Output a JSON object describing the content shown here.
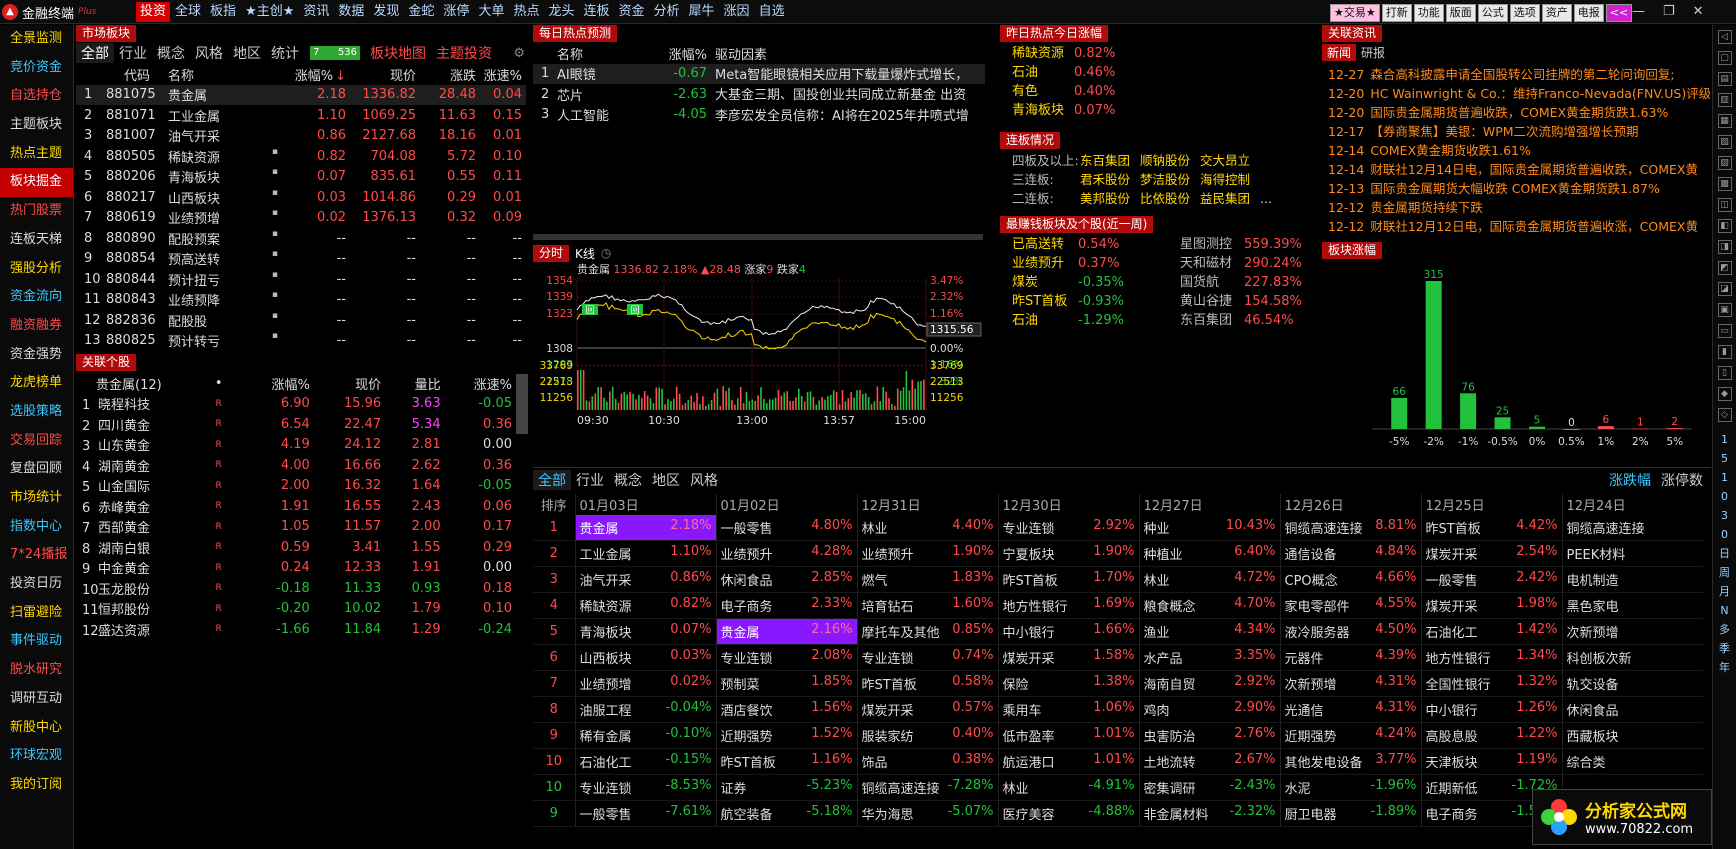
{
  "app": {
    "title": "金融终端",
    "tag": "Plus"
  },
  "menu": [
    "投资",
    "全球",
    "板指",
    "★主创★",
    "资讯",
    "数据",
    "发现",
    "金蛇",
    "涨停",
    "大单",
    "热点",
    "龙头",
    "连板",
    "资金",
    "分析",
    "犀牛",
    "涨因",
    "自选"
  ],
  "top_buttons": [
    "★交易★",
    "打新",
    "功能",
    "版面",
    "公式",
    "选项",
    "资产",
    "电报",
    "<<"
  ],
  "window_controls": [
    "—",
    "❐",
    "✕"
  ],
  "left_nav": [
    {
      "l": "全景监测",
      "c": "y"
    },
    {
      "l": "竞价资金",
      "c": "c"
    },
    {
      "l": "自选持仓",
      "c": "r"
    },
    {
      "l": "主题板块",
      "c": "w"
    },
    {
      "l": "热点主题",
      "c": "y"
    },
    {
      "l": "板块掘金",
      "c": "act"
    },
    {
      "l": "热门股票",
      "c": "r"
    },
    {
      "l": "连板天梯",
      "c": "w"
    },
    {
      "l": "强股分析",
      "c": "y"
    },
    {
      "l": "资金流向",
      "c": "c"
    },
    {
      "l": "融资融券",
      "c": "r"
    },
    {
      "l": "资金强势",
      "c": "w"
    },
    {
      "l": "龙虎榜单",
      "c": "y"
    },
    {
      "l": "选股策略",
      "c": "c"
    },
    {
      "l": "交易回踪",
      "c": "r"
    },
    {
      "l": "复盘回顾",
      "c": "w"
    },
    {
      "l": "市场统计",
      "c": "y"
    },
    {
      "l": "指数中心",
      "c": "c"
    },
    {
      "l": "7*24播报",
      "c": "r"
    },
    {
      "l": "投资日历",
      "c": "w"
    },
    {
      "l": "扫雷避险",
      "c": "y"
    },
    {
      "l": "事件驱动",
      "c": "c"
    },
    {
      "l": "脱水研究",
      "c": "r"
    },
    {
      "l": "调研互动",
      "c": "w"
    },
    {
      "l": "新股中心",
      "c": "y"
    },
    {
      "l": "环球宏观",
      "c": "c"
    },
    {
      "l": "我的订阅",
      "c": "y"
    }
  ],
  "right_tool_text": [
    "1",
    "5",
    "1",
    "0",
    "3",
    "0",
    "日",
    "周",
    "月",
    "N",
    "多",
    "季",
    "年"
  ],
  "market": {
    "header": "市场板块",
    "tabs": [
      "全部",
      "行业",
      "概念",
      "风格",
      "地区",
      "统计"
    ],
    "count_box": {
      "a": "7",
      "b": "536"
    },
    "links": [
      "板块地图",
      "主题投资"
    ],
    "cols": [
      "",
      "代码",
      "名称",
      "涨幅%",
      "现价",
      "涨跌",
      "涨速%"
    ],
    "sort_mark": "↓",
    "rows": [
      {
        "n": "1",
        "code": "881075",
        "name": "贵金属",
        "dot": "",
        "pct": "2.18",
        "px": "1336.82",
        "chg": "28.48",
        "spd": "0.04",
        "c": "r",
        "sel": true
      },
      {
        "n": "2",
        "code": "881071",
        "name": "工业金属",
        "dot": "",
        "pct": "1.10",
        "px": "1069.25",
        "chg": "11.63",
        "spd": "0.15",
        "c": "r"
      },
      {
        "n": "3",
        "code": "881007",
        "name": "油气开采",
        "dot": "",
        "pct": "0.86",
        "px": "2127.68",
        "chg": "18.16",
        "spd": "0.01",
        "c": "r"
      },
      {
        "n": "4",
        "code": "880505",
        "name": "稀缺资源",
        "dot": "▪",
        "pct": "0.82",
        "px": "704.08",
        "chg": "5.72",
        "spd": "0.10",
        "c": "r"
      },
      {
        "n": "5",
        "code": "880206",
        "name": "青海板块",
        "dot": "▪",
        "pct": "0.07",
        "px": "835.61",
        "chg": "0.55",
        "spd": "0.11",
        "c": "r"
      },
      {
        "n": "6",
        "code": "880217",
        "name": "山西板块",
        "dot": "▪",
        "pct": "0.03",
        "px": "1014.86",
        "chg": "0.29",
        "spd": "0.01",
        "c": "r"
      },
      {
        "n": "7",
        "code": "880619",
        "name": "业绩预增",
        "dot": "▪",
        "pct": "0.02",
        "px": "1376.13",
        "chg": "0.32",
        "spd": "0.09",
        "c": "r"
      },
      {
        "n": "8",
        "code": "880890",
        "name": "配股预案",
        "dot": "▪",
        "pct": "--",
        "px": "--",
        "chg": "--",
        "spd": "--",
        "c": "w"
      },
      {
        "n": "9",
        "code": "880854",
        "name": "预高送转",
        "dot": "▪",
        "pct": "--",
        "px": "--",
        "chg": "--",
        "spd": "--",
        "c": "w"
      },
      {
        "n": "10",
        "code": "880844",
        "name": "预计扭亏",
        "dot": "▪",
        "pct": "--",
        "px": "--",
        "chg": "--",
        "spd": "--",
        "c": "w"
      },
      {
        "n": "11",
        "code": "880843",
        "name": "业绩预降",
        "dot": "▪",
        "pct": "--",
        "px": "--",
        "chg": "--",
        "spd": "--",
        "c": "w"
      },
      {
        "n": "12",
        "code": "882836",
        "name": "配股股",
        "dot": "▪",
        "pct": "--",
        "px": "--",
        "chg": "--",
        "spd": "--",
        "c": "w"
      },
      {
        "n": "13",
        "code": "880825",
        "name": "预计转亏",
        "dot": "▪",
        "pct": "--",
        "px": "--",
        "chg": "--",
        "spd": "--",
        "c": "w"
      }
    ]
  },
  "related": {
    "header": "关联个股",
    "cols": [
      "贵金属(12)",
      "•",
      "涨幅%",
      "现价",
      "量比",
      "涨速%"
    ],
    "rows": [
      {
        "n": "1",
        "name": "晓程科技",
        "pct": "6.90",
        "px": "15.96",
        "vr": "3.63",
        "spd": "-0.05",
        "c": "r",
        "vc": "m",
        "sc": "g"
      },
      {
        "n": "2",
        "name": "四川黄金",
        "pct": "6.54",
        "px": "22.47",
        "vr": "5.34",
        "spd": "0.36",
        "c": "r",
        "vc": "m",
        "sc": "r"
      },
      {
        "n": "3",
        "name": "山东黄金",
        "pct": "4.19",
        "px": "24.12",
        "vr": "2.81",
        "spd": "0.00",
        "c": "r",
        "vc": "r",
        "sc": "w"
      },
      {
        "n": "4",
        "name": "湖南黄金",
        "pct": "4.00",
        "px": "16.66",
        "vr": "2.62",
        "spd": "0.36",
        "c": "r",
        "vc": "r",
        "sc": "r"
      },
      {
        "n": "5",
        "name": "山金国际",
        "pct": "2.00",
        "px": "16.32",
        "vr": "1.64",
        "spd": "-0.05",
        "c": "r",
        "vc": "r",
        "sc": "g"
      },
      {
        "n": "6",
        "name": "赤峰黄金",
        "pct": "1.91",
        "px": "16.55",
        "vr": "2.43",
        "spd": "0.06",
        "c": "r",
        "vc": "r",
        "sc": "r"
      },
      {
        "n": "7",
        "name": "西部黄金",
        "pct": "1.05",
        "px": "11.57",
        "vr": "2.00",
        "spd": "0.17",
        "c": "r",
        "vc": "r",
        "sc": "r"
      },
      {
        "n": "8",
        "name": "湖南白银",
        "pct": "0.59",
        "px": "3.41",
        "vr": "1.55",
        "spd": "0.29",
        "c": "r",
        "vc": "r",
        "sc": "r"
      },
      {
        "n": "9",
        "name": "中金黄金",
        "pct": "0.24",
        "px": "12.33",
        "vr": "1.91",
        "spd": "0.00",
        "c": "r",
        "vc": "r",
        "sc": "w"
      },
      {
        "n": "10",
        "name": "玉龙股份",
        "pct": "-0.18",
        "px": "11.33",
        "vr": "0.93",
        "spd": "0.18",
        "c": "g",
        "vc": "g",
        "sc": "r"
      },
      {
        "n": "11",
        "name": "恒邦股份",
        "pct": "-0.20",
        "px": "10.02",
        "vr": "1.79",
        "spd": "0.10",
        "c": "g",
        "vc": "r",
        "sc": "r"
      },
      {
        "n": "12",
        "name": "盛达资源",
        "pct": "-1.66",
        "px": "11.84",
        "vr": "1.29",
        "spd": "-0.24",
        "c": "g",
        "vc": "r",
        "sc": "g"
      }
    ]
  },
  "hot": {
    "header": "每日热点预测",
    "cols": [
      "名称",
      "涨幅%",
      "驱动因素"
    ],
    "rows": [
      {
        "n": "1",
        "name": "AI眼镜",
        "pct": "-0.67",
        "desc": "Meta智能眼镜相关应用下载量爆炸式增长，"
      },
      {
        "n": "2",
        "name": "芯片",
        "pct": "-2.63",
        "desc": "大基金三期、国投创业共同成立新基金 出资"
      },
      {
        "n": "3",
        "name": "人工智能",
        "pct": "-4.05",
        "desc": "李彦宏发全员信称：AI将在2025年井喷式增"
      }
    ]
  },
  "yesterday": {
    "header": "昨日热点今日涨幅",
    "rows": [
      {
        "name": "稀缺资源",
        "pct": "0.82%"
      },
      {
        "name": "石油",
        "pct": "0.46%"
      },
      {
        "name": "有色",
        "pct": "0.40%"
      },
      {
        "name": "青海板块",
        "pct": "0.07%"
      }
    ]
  },
  "board": {
    "header": "连板情况",
    "rows": [
      {
        "label": "四板及以上:",
        "stocks": [
          "东百集团",
          "顺钠股份",
          "交大昂立"
        ],
        "more": ""
      },
      {
        "label": "三连板:",
        "stocks": [
          "君禾股份",
          "梦洁股份",
          "海得控制"
        ],
        "more": ""
      },
      {
        "label": "二连板:",
        "stocks": [
          "美邦股份",
          "比依股份",
          "益民集团"
        ],
        "more": "..."
      }
    ]
  },
  "profit": {
    "header": "最赚钱板块及个股(近一周)",
    "left": [
      {
        "name": "已高送转",
        "pct": "0.54%",
        "c": "r"
      },
      {
        "name": "业绩预升",
        "pct": "0.37%",
        "c": "r"
      },
      {
        "name": "煤炭",
        "pct": "-0.35%",
        "c": "g"
      },
      {
        "name": "昨ST首板",
        "pct": "-0.93%",
        "c": "g"
      },
      {
        "name": "石油",
        "pct": "-1.29%",
        "c": "g"
      }
    ],
    "right": [
      {
        "name": "星图测控",
        "pct": "559.39%"
      },
      {
        "name": "天和磁材",
        "pct": "290.24%"
      },
      {
        "name": "国货航",
        "pct": "227.83%"
      },
      {
        "name": "黄山谷捷",
        "pct": "154.58%"
      },
      {
        "name": "东百集团",
        "pct": "46.54%"
      }
    ]
  },
  "news": {
    "header": "关联资讯",
    "tabs": [
      "新闻",
      "研报"
    ],
    "items": [
      {
        "d": "12-27",
        "t": "森合高科披露申请全国股转公司挂牌的第二轮问询回复;"
      },
      {
        "d": "12-20",
        "t": "HC Wainwright & Co.：维持Franco-Nevada(FNV.US)评级"
      },
      {
        "d": "12-20",
        "t": "国际贵金属期货普遍收跌，COMEX黄金期货跌1.63%"
      },
      {
        "d": "12-17",
        "t": "【券商聚焦】美银：WPM二次流购增强增长预期"
      },
      {
        "d": "12-14",
        "t": "COMEX黄金期货收跌1.61%"
      },
      {
        "d": "12-14",
        "t": "财联社12月14日电，国际贵金属期货普遍收跌，COMEX黄"
      },
      {
        "d": "12-13",
        "t": "国际贵金属期货大幅收跌 COMEX黄金期货跌1.87%"
      },
      {
        "d": "12-12",
        "t": "贵金属期货持续下跌"
      },
      {
        "d": "12-12",
        "t": "财联社12月12日电，国际贵金属期货普遍收涨，COMEX黄"
      }
    ]
  },
  "intraday": {
    "tabs": [
      "分时",
      "K线"
    ],
    "label": "贵金属",
    "price": "1336.82",
    "pct": "2.18%",
    "chg": "▲28.48",
    "up_label": "涨家",
    "up": "9",
    "down_label": "跌家",
    "down": "4",
    "left_ticks": [
      "1354",
      "1339",
      "1323",
      "1308",
      "1293",
      "1278",
      "33769",
      "22513",
      "11256"
    ],
    "right_ticks": [
      "3.47%",
      "2.32%",
      "1.16%",
      "0.00%",
      "1.16%",
      "2.32%",
      "33769",
      "22513",
      "11256"
    ],
    "right_ticks_color": [
      "r",
      "r",
      "r",
      "w",
      "g",
      "g",
      "y",
      "y",
      "y"
    ],
    "price_box": "1315.56",
    "times": [
      "09:30",
      "10:30",
      "13:00",
      "13:57",
      "15:00"
    ],
    "badges": [
      "回",
      "回"
    ]
  },
  "dist": {
    "header": "板块涨幅",
    "chart_data": {
      "type": "bar",
      "categories": [
        "-5%",
        "-2%",
        "-1%",
        "-0.5%",
        "0%",
        "0.5%",
        "1%",
        "2%",
        "5%"
      ],
      "values": [
        66,
        315,
        76,
        25,
        5,
        0,
        6,
        1,
        2
      ],
      "colors": [
        "#22c23c",
        "#22c23c",
        "#22c23c",
        "#22c23c",
        "#22c23c",
        "#ffffff",
        "#ff4b4b",
        "#ff4b4b",
        "#ff4b4b"
      ]
    }
  },
  "history": {
    "tabs": [
      "全部",
      "行业",
      "概念",
      "地区",
      "风格"
    ],
    "right_tabs": [
      "涨跌幅",
      "涨停数"
    ],
    "rank_label": "排序",
    "dates": [
      "01月03日",
      "01月02日",
      "12月31日",
      "12月30日",
      "12月27日",
      "12月26日",
      "12月25日",
      "12月24日"
    ],
    "ranks": [
      "1",
      "2",
      "3",
      "4",
      "5",
      "6",
      "7",
      "8",
      "9",
      "10",
      "10",
      "9"
    ],
    "cols": [
      [
        [
          "贵金属",
          "2.18%"
        ],
        [
          "工业金属",
          "1.10%"
        ],
        [
          "油气开采",
          "0.86%"
        ],
        [
          "稀缺资源",
          "0.82%"
        ],
        [
          "青海板块",
          "0.07%"
        ],
        [
          "山西板块",
          "0.03%"
        ],
        [
          "业绩预增",
          "0.02%"
        ],
        [
          "油服工程",
          "-0.04%"
        ],
        [
          "稀有金属",
          "-0.10%"
        ],
        [
          "石油化工",
          "-0.15%"
        ],
        [
          "专业连锁",
          "-8.53%"
        ],
        [
          "一般零售",
          "-7.61%"
        ]
      ],
      [
        [
          "一般零售",
          "4.80%"
        ],
        [
          "业绩预升",
          "4.28%"
        ],
        [
          "休闲食品",
          "2.85%"
        ],
        [
          "电子商务",
          "2.33%"
        ],
        [
          "贵金属",
          "2.16%"
        ],
        [
          "专业连锁",
          "2.08%"
        ],
        [
          "预制菜",
          "1.85%"
        ],
        [
          "酒店餐饮",
          "1.56%"
        ],
        [
          "近期强势",
          "1.52%"
        ],
        [
          "昨ST首板",
          "1.16%"
        ],
        [
          "证券",
          "-5.23%"
        ],
        [
          "航空装备",
          "-5.18%"
        ]
      ],
      [
        [
          "林业",
          "4.40%"
        ],
        [
          "业绩预升",
          "1.90%"
        ],
        [
          "燃气",
          "1.83%"
        ],
        [
          "培育钻石",
          "1.60%"
        ],
        [
          "摩托车及其他",
          "0.85%"
        ],
        [
          "专业连锁",
          "0.74%"
        ],
        [
          "昨ST首板",
          "0.58%"
        ],
        [
          "煤炭开采",
          "0.57%"
        ],
        [
          "服装家纺",
          "0.40%"
        ],
        [
          "饰品",
          "0.38%"
        ],
        [
          "铜缆高速连接",
          "-7.28%"
        ],
        [
          "华为海思",
          "-5.07%"
        ]
      ],
      [
        [
          "专业连锁",
          "2.92%"
        ],
        [
          "宁夏板块",
          "1.90%"
        ],
        [
          "昨ST首板",
          "1.70%"
        ],
        [
          "地方性银行",
          "1.69%"
        ],
        [
          "中小银行",
          "1.66%"
        ],
        [
          "煤炭开采",
          "1.58%"
        ],
        [
          "保险",
          "1.38%"
        ],
        [
          "乘用车",
          "1.06%"
        ],
        [
          "低市盈率",
          "1.01%"
        ],
        [
          "航运港口",
          "1.01%"
        ],
        [
          "林业",
          "-4.91%"
        ],
        [
          "医疗美容",
          "-4.88%"
        ]
      ],
      [
        [
          "种业",
          "10.43%"
        ],
        [
          "种植业",
          "6.40%"
        ],
        [
          "林业",
          "4.72%"
        ],
        [
          "粮食概念",
          "4.70%"
        ],
        [
          "渔业",
          "4.34%"
        ],
        [
          "水产品",
          "3.35%"
        ],
        [
          "海南自贸",
          "2.92%"
        ],
        [
          "鸡肉",
          "2.90%"
        ],
        [
          "虫害防治",
          "2.76%"
        ],
        [
          "土地流转",
          "2.67%"
        ],
        [
          "密集调研",
          "-2.43%"
        ],
        [
          "非金属材料",
          "-2.32%"
        ]
      ],
      [
        [
          "铜缆高速连接",
          "8.81%"
        ],
        [
          "通信设备",
          "4.84%"
        ],
        [
          "CPO概念",
          "4.66%"
        ],
        [
          "家电零部件",
          "4.55%"
        ],
        [
          "液冷服务器",
          "4.50%"
        ],
        [
          "元器件",
          "4.39%"
        ],
        [
          "次新预增",
          "4.31%"
        ],
        [
          "光通信",
          "4.31%"
        ],
        [
          "近期强势",
          "4.24%"
        ],
        [
          "其他发电设备",
          "3.77%"
        ],
        [
          "水泥",
          "-1.96%"
        ],
        [
          "厨卫电器",
          "-1.89%"
        ]
      ],
      [
        [
          "昨ST首板",
          "4.42%"
        ],
        [
          "煤炭开采",
          "2.54%"
        ],
        [
          "一般零售",
          "2.42%"
        ],
        [
          "煤炭开采",
          "1.98%"
        ],
        [
          "石油化工",
          "1.42%"
        ],
        [
          "地方性银行",
          "1.34%"
        ],
        [
          "全国性银行",
          "1.32%"
        ],
        [
          "中小银行",
          "1.26%"
        ],
        [
          "高股息股",
          "1.22%"
        ],
        [
          "天津板块",
          "1.19%"
        ],
        [
          "近期新低",
          "-1.72%"
        ],
        [
          "电子商务",
          "-1.59%"
        ]
      ],
      [
        [
          "铜缆高速连接",
          ""
        ],
        [
          "PEEK材料",
          ""
        ],
        [
          "电机制造",
          ""
        ],
        [
          "黑色家电",
          ""
        ],
        [
          "次新预增",
          ""
        ],
        [
          "科创板次新",
          ""
        ],
        [
          "轨交设备",
          ""
        ],
        [
          "休闲食品",
          ""
        ],
        [
          "西藏板块",
          ""
        ],
        [
          "综合类",
          ""
        ],
        [
          "",
          ""
        ],
        [
          "",
          ""
        ]
      ]
    ],
    "highlights": [
      [
        0,
        0
      ],
      [
        1,
        4
      ]
    ]
  },
  "watermark": {
    "line1": "分析家公式网",
    "line2": "www.70822.com"
  }
}
